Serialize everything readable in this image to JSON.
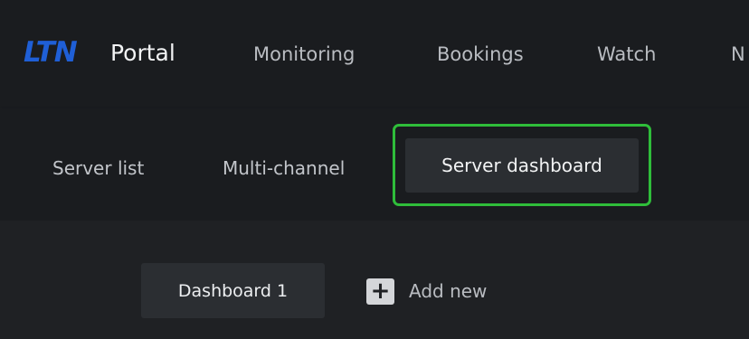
{
  "header": {
    "logo_text": "LTN",
    "app_name": "Portal",
    "nav": [
      {
        "label": "Monitoring"
      },
      {
        "label": "Bookings"
      },
      {
        "label": "Watch"
      },
      {
        "label": "N"
      }
    ]
  },
  "subnav": {
    "tabs": [
      {
        "label": "Server list"
      },
      {
        "label": "Multi-channel"
      },
      {
        "label": "Server dashboard",
        "active": true
      }
    ]
  },
  "dashboards": {
    "tabs": [
      {
        "label": "Dashboard 1"
      }
    ],
    "add_new_label": "Add new",
    "add_icon": "plus-icon"
  },
  "colors": {
    "brand": "#1f5fd6",
    "highlight": "#2fbd3a",
    "background": "#1a1c1f"
  }
}
